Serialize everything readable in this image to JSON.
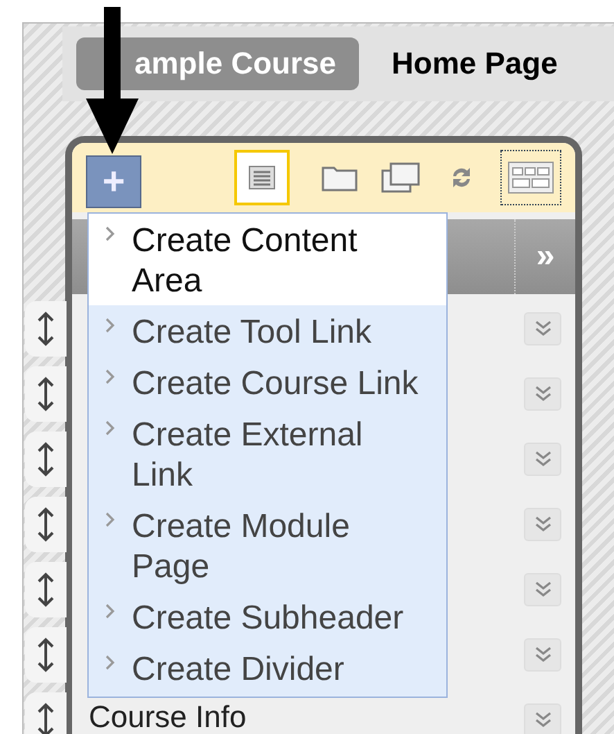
{
  "breadcrumb": {
    "course": "ample Course",
    "page": "Home Page"
  },
  "toolbar": {
    "add_button": "+",
    "tools": [
      {
        "kind": "list",
        "selected": true
      },
      {
        "kind": "folder",
        "selected": false
      },
      {
        "kind": "windows",
        "selected": false
      },
      {
        "kind": "refresh",
        "selected": false
      },
      {
        "kind": "layout",
        "selected": false
      }
    ]
  },
  "header": {
    "expand": "»"
  },
  "rows": [
    {
      "kind": "item"
    },
    {
      "kind": "item"
    },
    {
      "kind": "item"
    },
    {
      "kind": "item"
    },
    {
      "kind": "item"
    },
    {
      "kind": "item"
    },
    {
      "kind": "item",
      "label": "Course Info"
    }
  ],
  "menu": [
    {
      "label": "Create Content Area",
      "highlighted": false
    },
    {
      "label": "Create Tool Link",
      "highlighted": true
    },
    {
      "label": "Create Course Link",
      "highlighted": true
    },
    {
      "label": "Create External Link",
      "highlighted": true
    },
    {
      "label": "Create Module Page",
      "highlighted": true
    },
    {
      "label": "Create Subheader",
      "highlighted": true
    },
    {
      "label": "Create Divider",
      "highlighted": true
    }
  ]
}
